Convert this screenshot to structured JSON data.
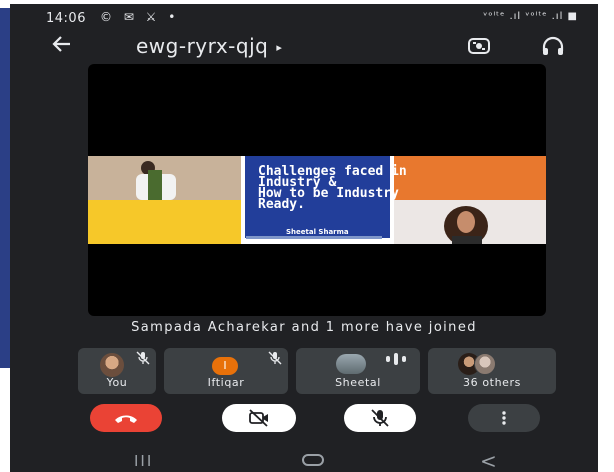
{
  "status_bar": {
    "time": "14:06",
    "left_icons": "© ✉ ⚔ •",
    "right_text": "ᵛᵒˡᵗᵉ .ıl ᵛᵒˡᵗᵉ .ıl ■"
  },
  "top_bar": {
    "back_icon": "arrow-back-icon",
    "meeting_code": "ewg-ryrx-qjq",
    "title_arrow": "▸",
    "flip_camera_icon": "flip-camera-icon",
    "audio_icon": "headphones-icon"
  },
  "presentation": {
    "slide_lines": [
      "Challenges faced in",
      "Industry &",
      "How to be Industry",
      "Ready."
    ],
    "author": "Sheetal Sharma"
  },
  "join_message": "Sampada Acharekar and 1 more have joined",
  "participants": [
    {
      "label": "You",
      "muted": true
    },
    {
      "label": "Iftiqar",
      "initial": "I",
      "muted": true
    },
    {
      "label": "Sheetal",
      "speaking": true
    },
    {
      "label": "36 others"
    }
  ],
  "controls": {
    "end_call_icon": "end-call-icon",
    "camera_icon": "camera-off-icon",
    "mic_icon": "mic-off-icon",
    "more_icon": "more-options-icon"
  },
  "nav_bar": {
    "recents": "III",
    "back": "<"
  },
  "colors": {
    "background": "#202124",
    "tile": "#3c4043",
    "end_call": "#ea4335",
    "orange_avatar": "#e8710a"
  }
}
